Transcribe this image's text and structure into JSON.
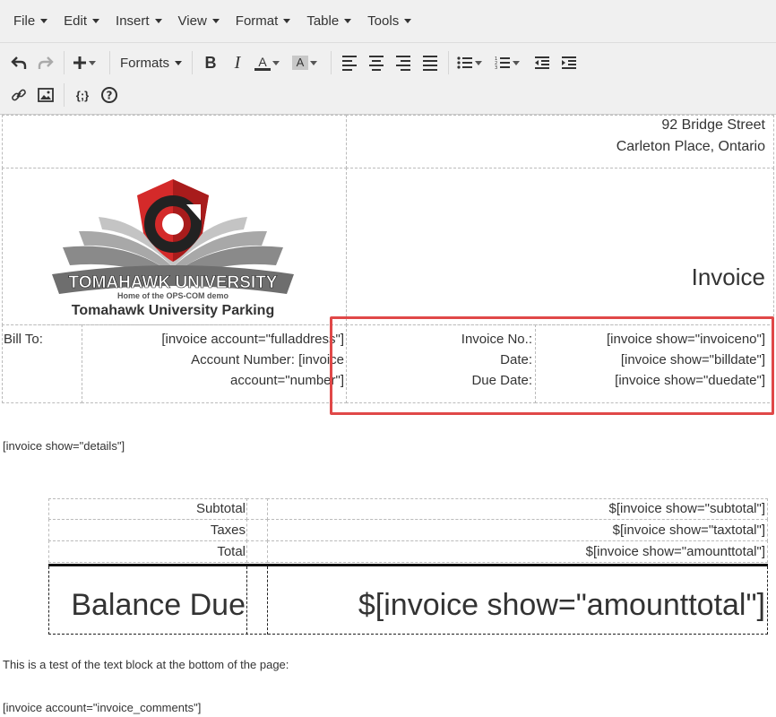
{
  "menubar": {
    "items": [
      {
        "label": "File"
      },
      {
        "label": "Edit"
      },
      {
        "label": "Insert"
      },
      {
        "label": "View"
      },
      {
        "label": "Format"
      },
      {
        "label": "Table"
      },
      {
        "label": "Tools"
      }
    ]
  },
  "toolbar": {
    "formats_label": "Formats",
    "bold_label": "B",
    "italic_label": "I",
    "font_color_label": "A",
    "bg_color_label": "A",
    "code_label": "{;}",
    "help_label": "?"
  },
  "document": {
    "address_line1": "92 Bridge Street",
    "address_line2": "Carleton Place, Ontario",
    "logo_title": "TOMAHAWK UNIVERSITY",
    "logo_subtitle": "Home of the OPS-COM demo",
    "logo_caption": "Tomahawk University Parking",
    "invoice_heading": "Invoice",
    "bill_to_label": "Bill To:",
    "bill_to_line1": "[invoice account=\"fulladdress\"]",
    "bill_to_line2": "Account Number: [invoice",
    "bill_to_line3": "account=\"number\"]",
    "invoice_no_label": "Invoice No.:",
    "invoice_no_value": "[invoice show=\"invoiceno\"]",
    "date_label": "Date:",
    "date_value": "[invoice show=\"billdate\"]",
    "due_date_label": "Due Date:",
    "due_date_value": "[invoice show=\"duedate\"]",
    "details_shortcode": "[invoice show=\"details\"]",
    "subtotal_label": "Subtotal",
    "subtotal_value": "$[invoice show=\"subtotal\"]",
    "taxes_label": "Taxes",
    "taxes_value": "$[invoice show=\"taxtotal\"]",
    "total_label": "Total",
    "total_value": "$[invoice show=\"amounttotal\"]",
    "balance_due_label": "Balance Due",
    "balance_due_value": "$[invoice show=\"amounttotal\"]",
    "bottom_text": "This is a test of the text block at the bottom of the page:",
    "comments_shortcode": "[invoice account=\"invoice_comments\"]"
  },
  "colors": {
    "highlight": "#e04848",
    "logo_red": "#d42a2a",
    "toolbar_bg": "#f0f0f0"
  }
}
